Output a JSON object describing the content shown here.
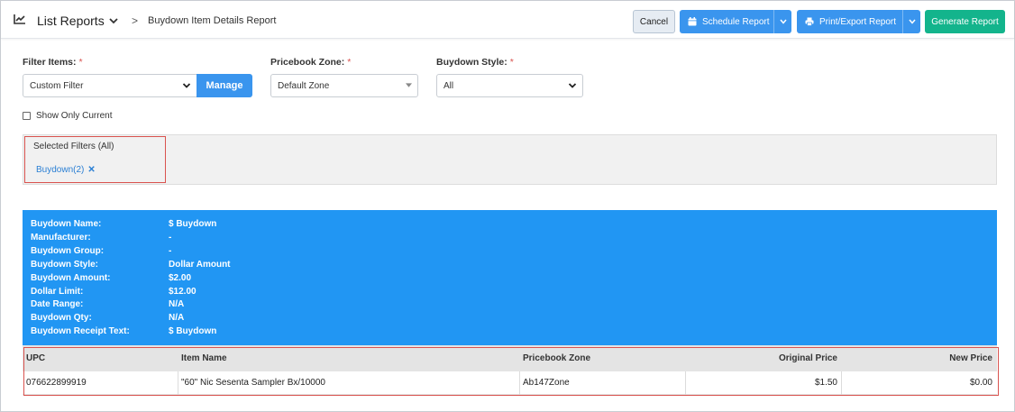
{
  "header": {
    "title": "List Reports",
    "breadcrumb_sep": ">",
    "breadcrumb": "Buydown Item Details Report",
    "cancel_label": "Cancel",
    "schedule_label": "Schedule Report",
    "print_label": "Print/Export Report",
    "generate_label": "Generate Report"
  },
  "filters": {
    "filter_items_label": "Filter Items:",
    "filter_items_value": "Custom Filter",
    "manage_label": "Manage",
    "pricebook_zone_label": "Pricebook Zone:",
    "pricebook_zone_value": "Default Zone",
    "buydown_style_label": "Buydown Style:",
    "buydown_style_value": "All",
    "required_marker": "*",
    "show_only_current_label": "Show Only Current"
  },
  "selected_filters": {
    "title": "Selected Filters (All)",
    "tag": "Buydown(2)",
    "remove": "✕"
  },
  "buydown_info": [
    {
      "label": "Buydown Name:",
      "value": "$ Buydown"
    },
    {
      "label": "Manufacturer:",
      "value": "-"
    },
    {
      "label": "Buydown Group:",
      "value": "-"
    },
    {
      "label": "Buydown Style:",
      "value": "Dollar Amount"
    },
    {
      "label": "Buydown Amount:",
      "value": "$2.00"
    },
    {
      "label": "Dollar Limit:",
      "value": "$12.00"
    },
    {
      "label": "Date Range:",
      "value": "N/A"
    },
    {
      "label": "Buydown Qty:",
      "value": "N/A"
    },
    {
      "label": "Buydown Receipt Text:",
      "value": "$ Buydown"
    }
  ],
  "table": {
    "headers": [
      "UPC",
      "Item Name",
      "Pricebook Zone",
      "Original Price",
      "New Price"
    ],
    "rows": [
      [
        "07662289991​9",
        "\"60\" Nic Sesenta Sampler Bx/10000",
        "Ab147Zone",
        "$1.50",
        "$0.00"
      ]
    ]
  },
  "colors": {
    "primary": "#3a95ee",
    "success": "#13b48c",
    "info_panel": "#2196f3",
    "highlight": "#d9534f"
  }
}
